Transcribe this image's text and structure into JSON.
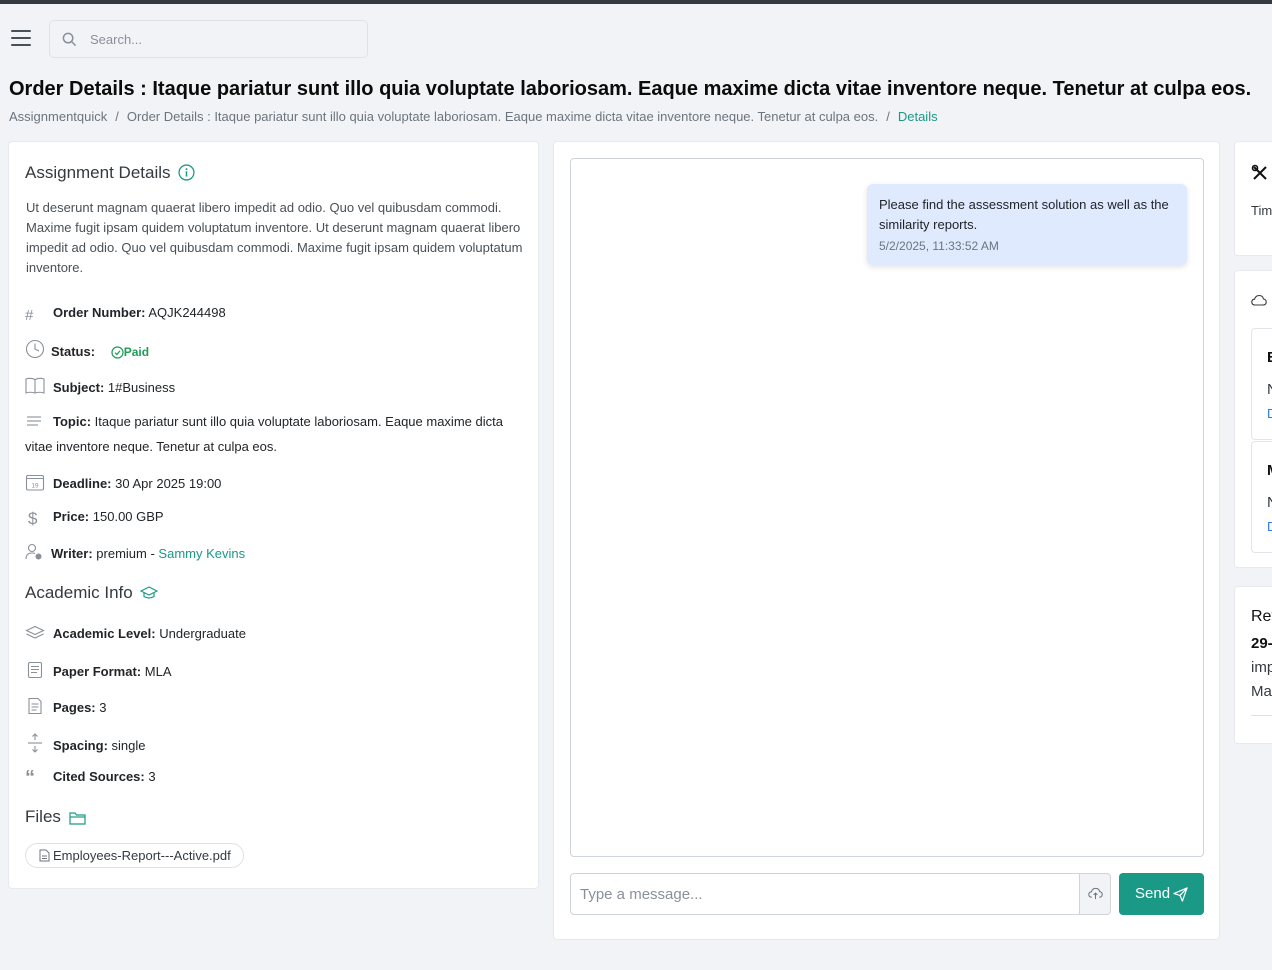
{
  "header": {
    "search_placeholder": "Search..."
  },
  "page": {
    "title": "Order Details : Itaque pariatur sunt illo quia voluptate laboriosam. Eaque maxime dicta vitae inventore neque. Tenetur at culpa eos.",
    "breadcrumb": [
      "Assignmentquick",
      "Order Details : Itaque pariatur sunt illo quia voluptate laboriosam. Eaque maxime dicta vitae inventore neque. Tenetur at culpa eos.",
      "Details"
    ]
  },
  "assignment": {
    "heading": "Assignment Details",
    "description": "Ut deserunt magnam quaerat libero impedit ad odio. Quo vel quibusdam commodi. Maxime fugit ipsam quidem voluptatum inventore. Ut deserunt magnam quaerat libero impedit ad odio. Quo vel quibusdam commodi. Maxime fugit ipsam quidem voluptatum inventore.",
    "order_number_label": "Order Number:",
    "order_number": "AQJK244498",
    "status_label": "Status:",
    "status": "Paid",
    "status_color": "#1e9e58",
    "subject_label": "Subject:",
    "subject": "1#Business",
    "topic_label": "Topic:",
    "topic": "Itaque pariatur sunt illo quia voluptate laboriosam. Eaque maxime dicta vitae inventore neque. Tenetur at culpa eos.",
    "deadline_label": "Deadline:",
    "deadline": "30 Apr 2025 19:00",
    "price_label": "Price:",
    "price": "150.00 GBP",
    "writer_label": "Writer:",
    "writer_level": "premium -",
    "writer_name": "Sammy Kevins"
  },
  "academic": {
    "heading": "Academic Info",
    "level_label": "Academic Level:",
    "level": "Undergraduate",
    "format_label": "Paper Format:",
    "format": "MLA",
    "pages_label": "Pages:",
    "pages": "3",
    "spacing_label": "Spacing:",
    "spacing": "single",
    "sources_label": "Cited Sources:",
    "sources": "3"
  },
  "files": {
    "heading": "Files",
    "items": [
      "Employees-Report---Active.pdf"
    ]
  },
  "chat": {
    "messages": [
      {
        "text": "Please find the assessment solution as well as the similarity reports.",
        "time": "5/2/2025, 11:33:52 AM"
      }
    ],
    "input_placeholder": "Type a message...",
    "send_label": "Send"
  },
  "right_panel": {
    "card1_text": "Tim",
    "card2_item1_title": "E",
    "card2_item1_line": "N",
    "card2_item1_link": "D",
    "card2_item2_title": "M",
    "card2_item2_line": "N",
    "card2_item2_link": "D",
    "card3_title": "Rev",
    "card3_date": "29-",
    "card3_line1": "imp",
    "card3_line2": "Ma"
  },
  "colors": {
    "accent": "#1a9a86",
    "bubble": "#dfeafe"
  }
}
